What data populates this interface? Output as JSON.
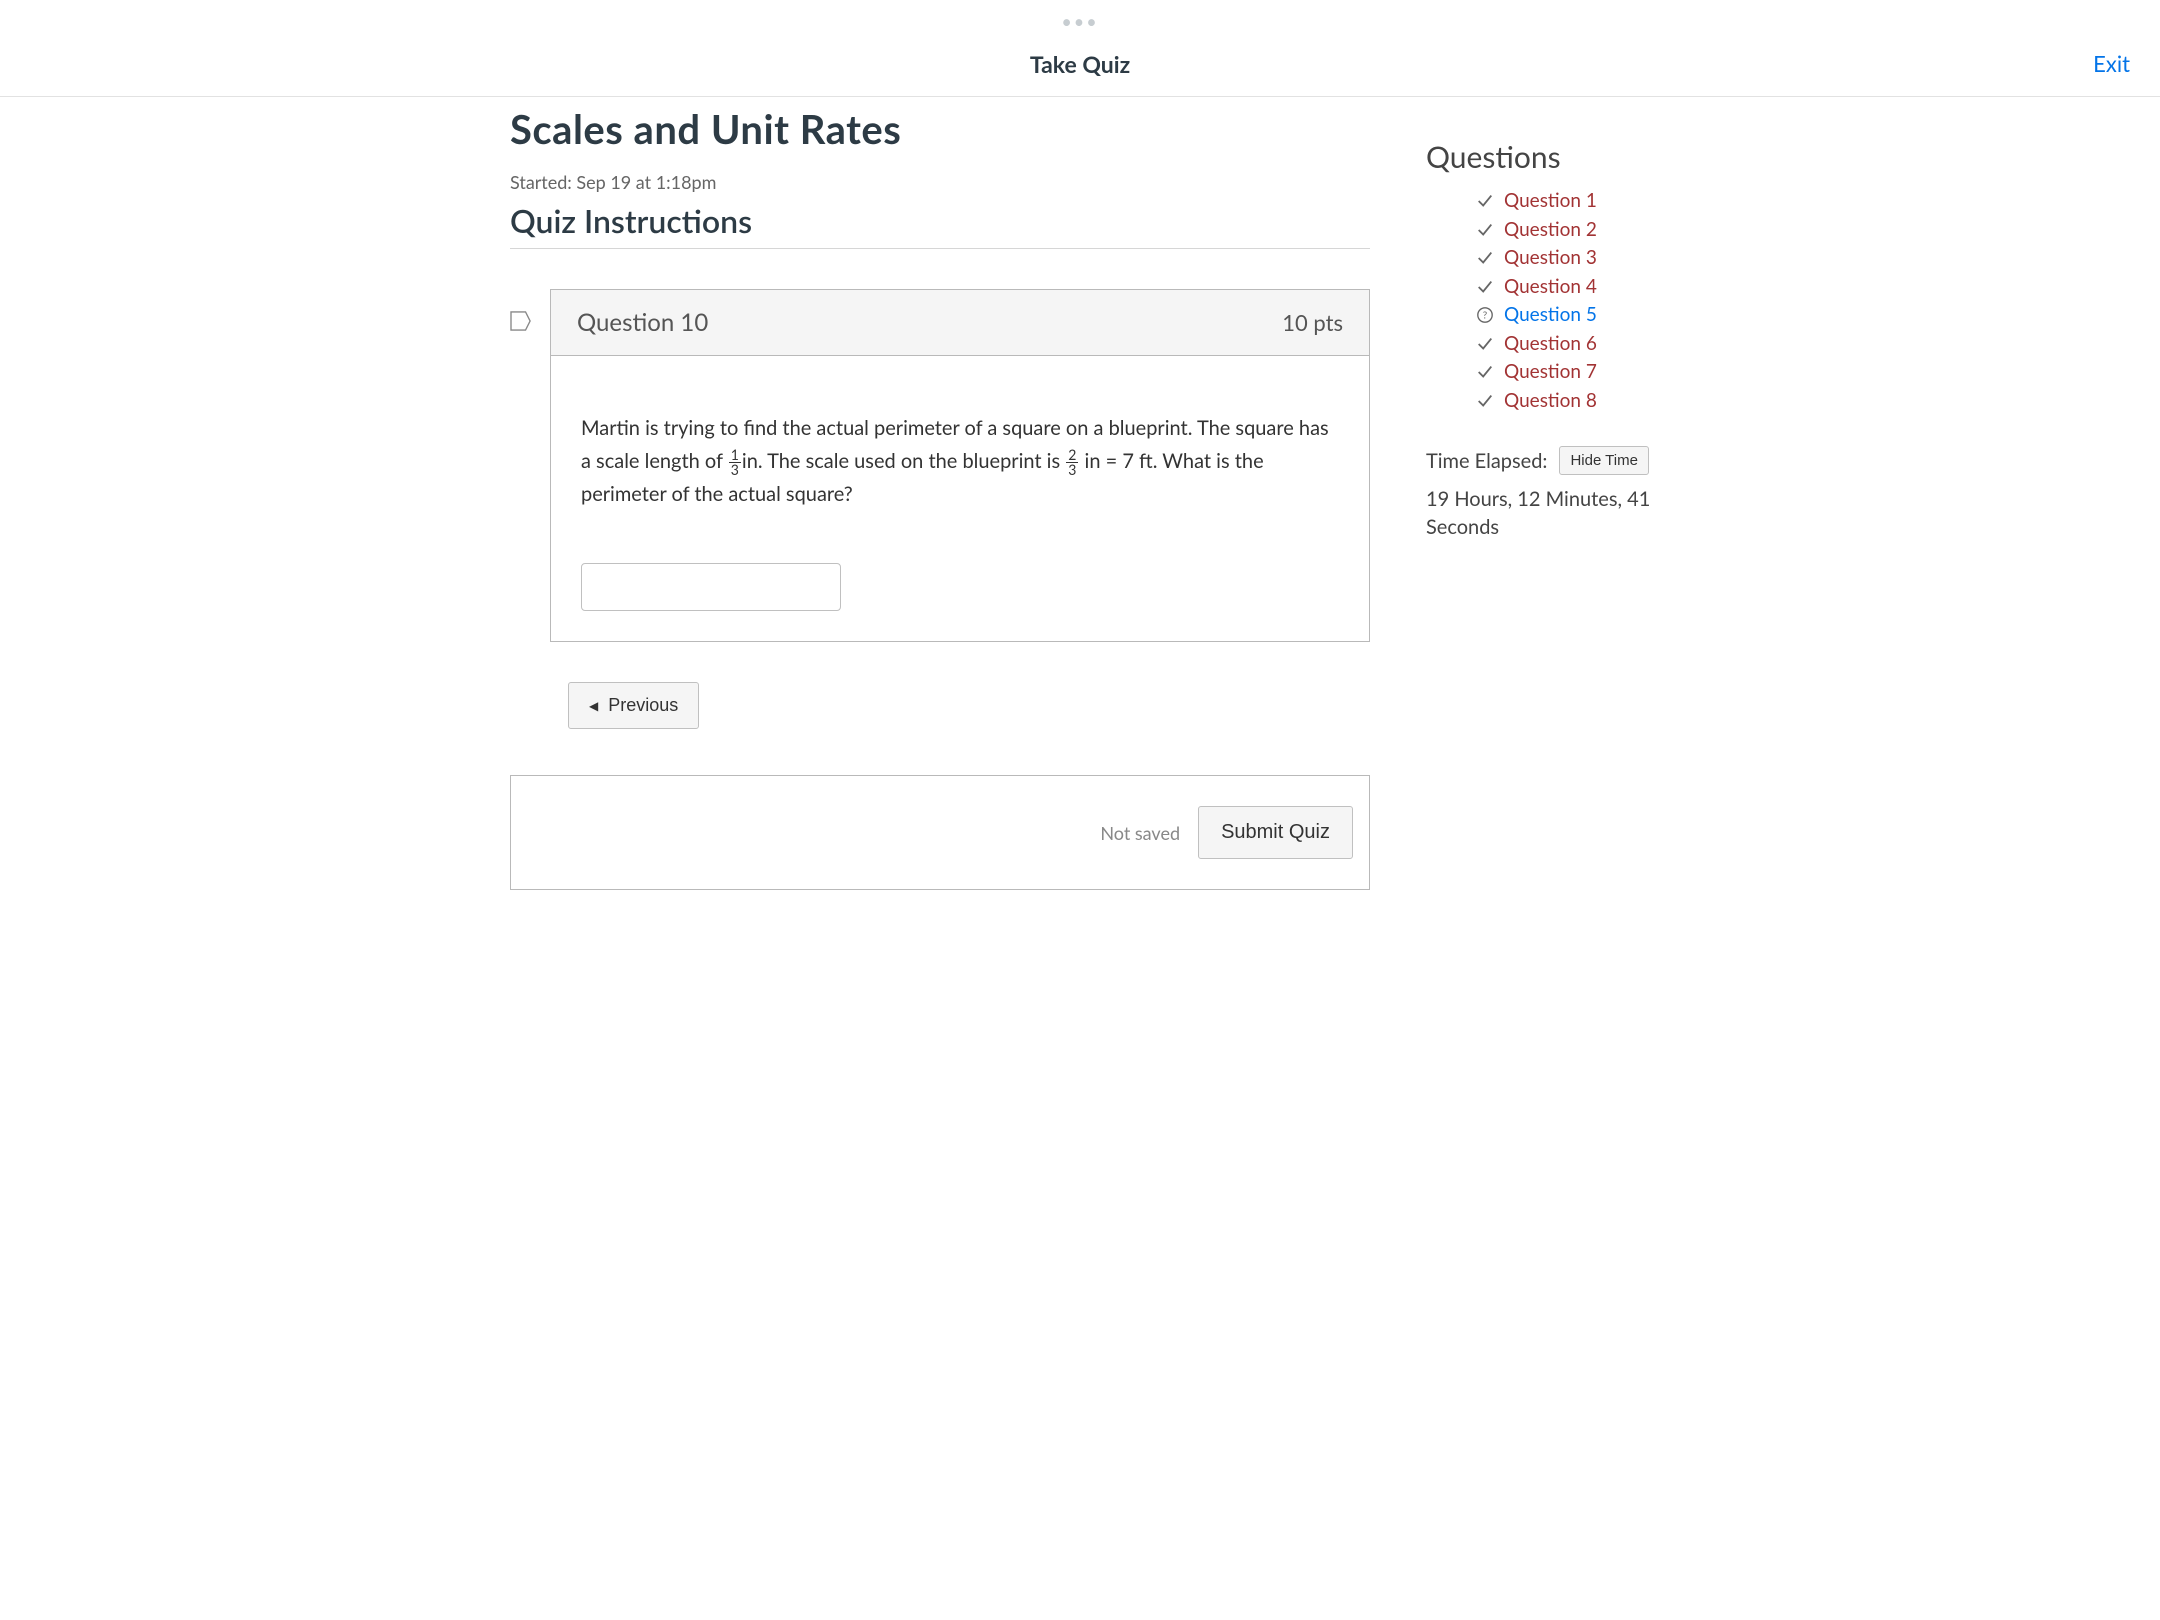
{
  "header": {
    "title": "Take Quiz",
    "exit_label": "Exit"
  },
  "quiz": {
    "title": "Scales and Unit Rates",
    "started_label": "Started: Sep 19 at 1:18pm",
    "instructions_title": "Quiz Instructions"
  },
  "question": {
    "label": "Question 10",
    "points_label": "10 pts",
    "answer_value": "",
    "text_part1": "Martin is trying to find the actual perimeter of a square on a blueprint.  The square has a scale length of ",
    "frac1_num": "1",
    "frac1_den": "3",
    "text_part2": "in.  The scale used on the blueprint is ",
    "frac2_num": "2",
    "frac2_den": "3",
    "text_part3": " in = 7 ft.  What is the perimeter of the actual square?"
  },
  "nav": {
    "previous_label": "Previous"
  },
  "submit": {
    "status_label": "Not saved",
    "button_label": "Submit Quiz"
  },
  "sidebar": {
    "heading": "Questions",
    "items": [
      {
        "label": "Question 1",
        "status": "answered"
      },
      {
        "label": "Question 2",
        "status": "answered"
      },
      {
        "label": "Question 3",
        "status": "answered"
      },
      {
        "label": "Question 4",
        "status": "answered"
      },
      {
        "label": "Question 5",
        "status": "unanswered"
      },
      {
        "label": "Question 6",
        "status": "answered"
      },
      {
        "label": "Question 7",
        "status": "answered"
      },
      {
        "label": "Question 8",
        "status": "answered"
      }
    ],
    "time_label": "Time Elapsed:",
    "hide_time_label": "Hide Time",
    "time_value": "19 Hours, 12 Minutes, 41 Seconds"
  }
}
